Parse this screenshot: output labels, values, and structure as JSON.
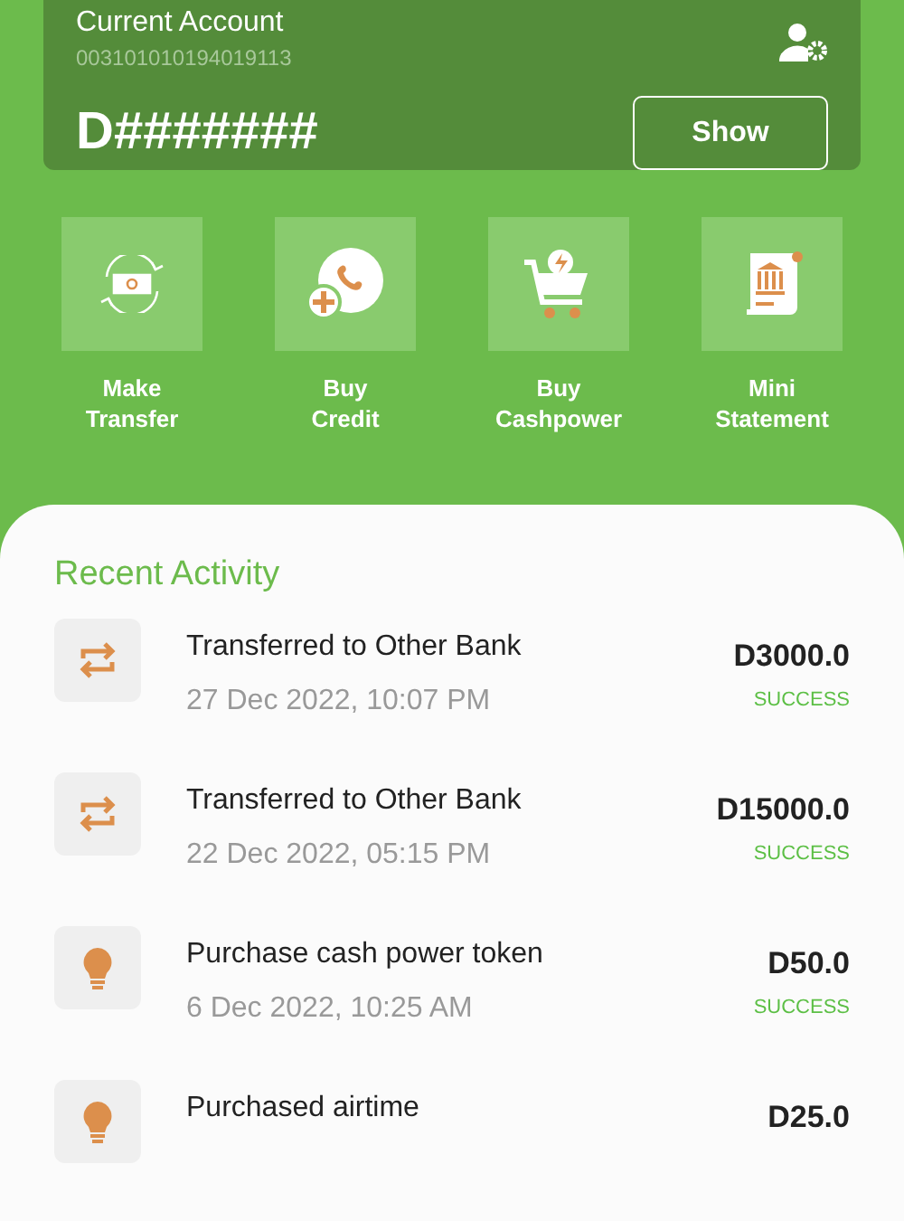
{
  "account": {
    "title": "Current Account",
    "number": "003101010194019113",
    "balance": "D#######",
    "show_button": "Show"
  },
  "actions": [
    {
      "kind": "transfer",
      "label": "Make\nTransfer"
    },
    {
      "kind": "credit",
      "label": "Buy\nCredit"
    },
    {
      "kind": "cashpower",
      "label": "Buy\nCashpower"
    },
    {
      "kind": "statement",
      "label": "Mini\nStatement"
    }
  ],
  "recent_activity": {
    "title": "Recent Activity",
    "items": [
      {
        "kind": "transfer",
        "title": "Transferred to Other Bank",
        "date": "27 Dec 2022, 10:07 PM",
        "amount": "D3000.0",
        "status": "SUCCESS"
      },
      {
        "kind": "transfer",
        "title": "Transferred to Other Bank",
        "date": "22 Dec 2022, 05:15 PM",
        "amount": "D15000.0",
        "status": "SUCCESS"
      },
      {
        "kind": "power",
        "title": "Purchase cash power token",
        "date": "6 Dec 2022, 10:25 AM",
        "amount": "D50.0",
        "status": "SUCCESS"
      },
      {
        "kind": "airtime",
        "title": "Purchased airtime",
        "amount": "D25.0"
      }
    ]
  }
}
